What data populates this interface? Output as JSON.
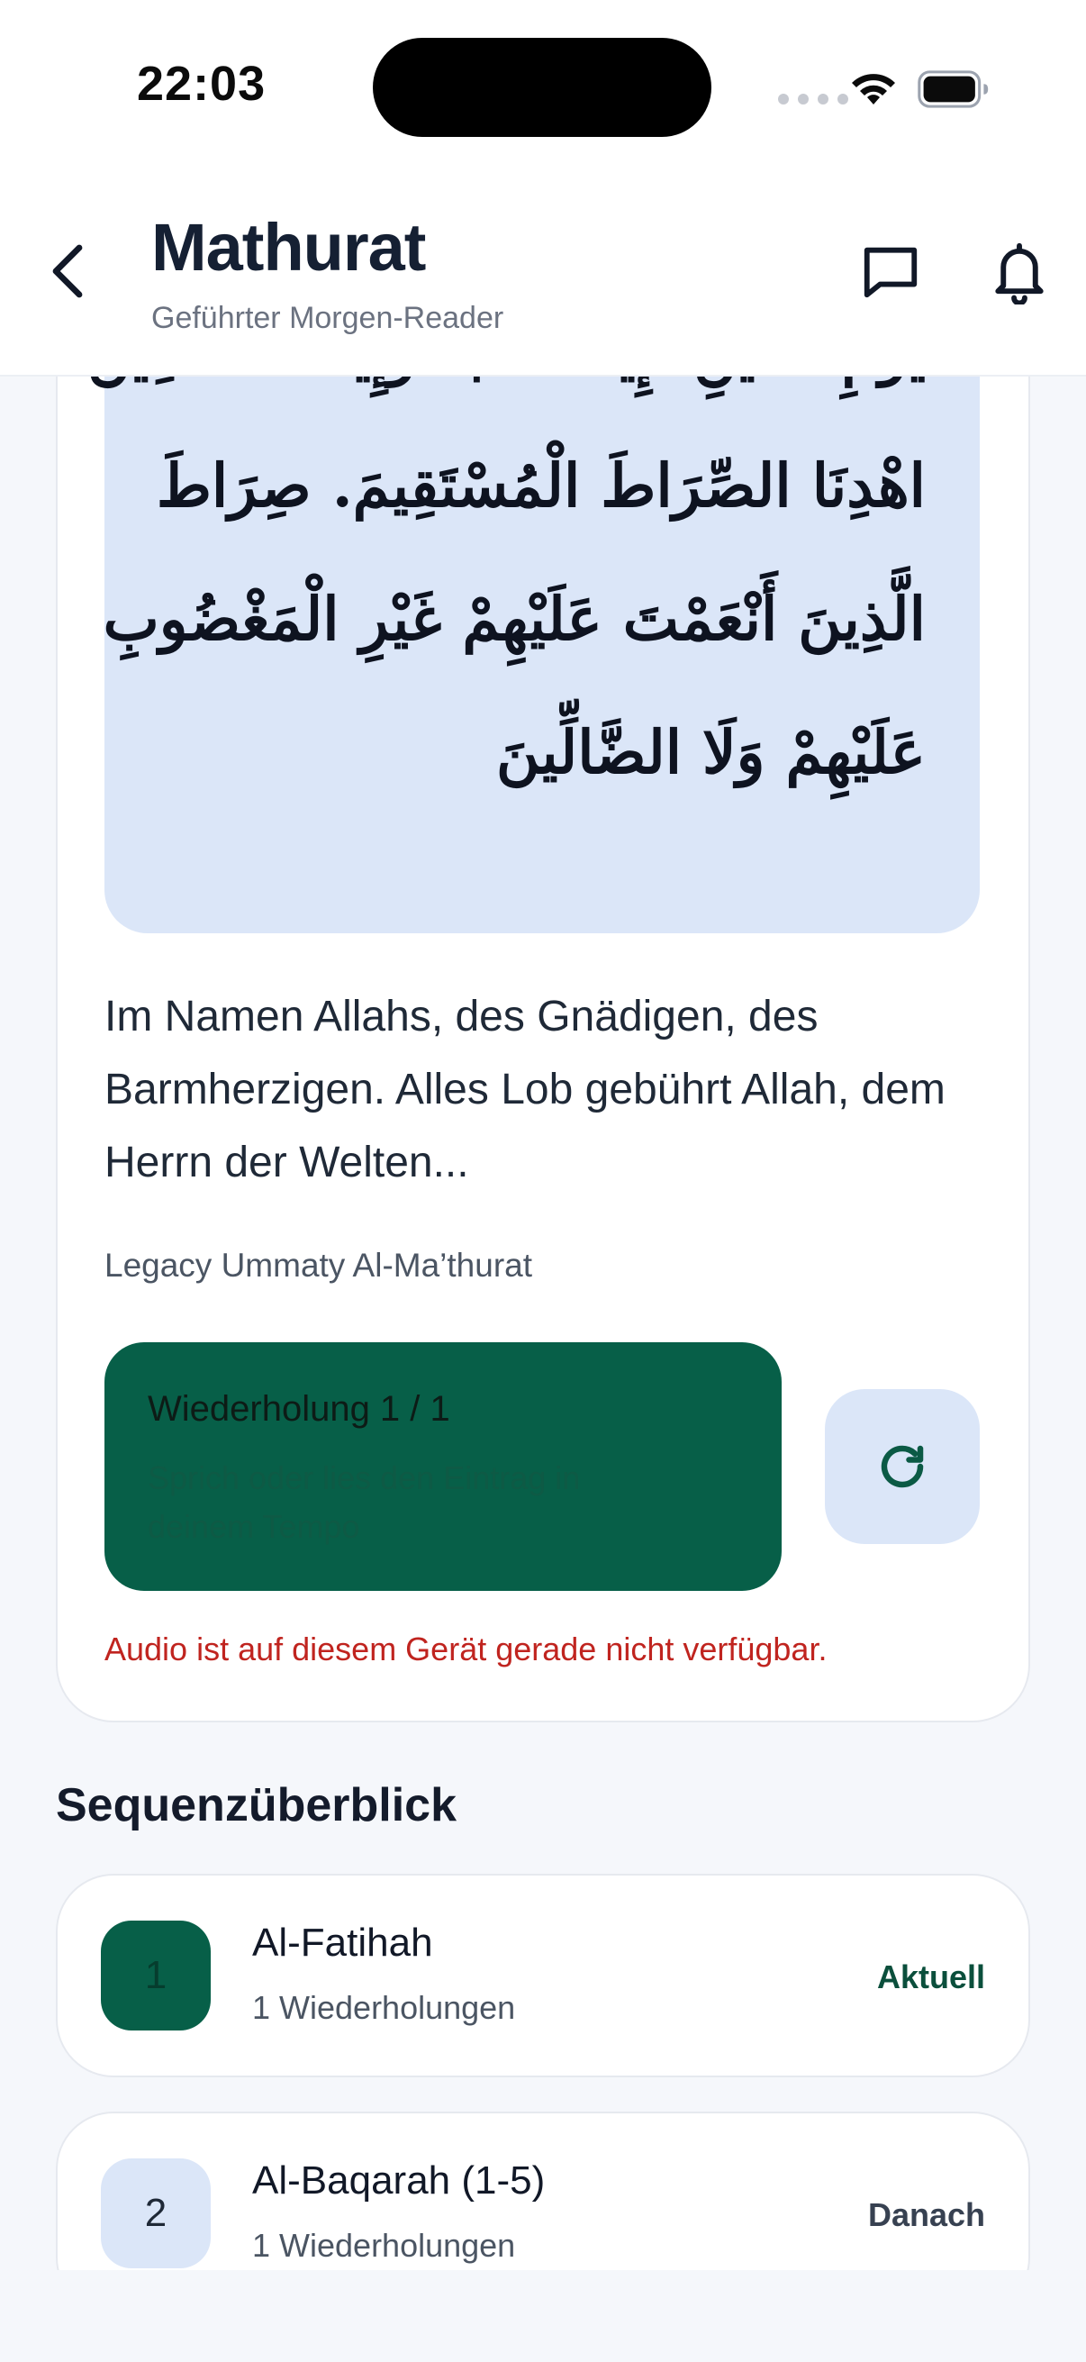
{
  "status_bar": {
    "time": "22:03"
  },
  "header": {
    "title": "Mathurat",
    "subtitle": "Geführter Morgen-Reader"
  },
  "reader": {
    "arabic_lines": [
      "يَوْمِ الدِّينِ. إِيَّاكَ نَعْبُدُ وَإِيَّاكَ نَسْتَعِينُ.",
      "اهْدِنَا الصِّرَاطَ الْمُسْتَقِيمَ. صِرَاطَ",
      "الَّذِينَ أَنْعَمْتَ عَلَيْهِمْ غَيْرِ الْمَغْضُوبِ",
      "عَلَيْهِمْ وَلَا الضَّالِّينَ"
    ],
    "translation": "Im Namen Allahs, des Gnädigen, des Barmherzigen. Alles Lob gebührt Allah, dem Herrn der Welten...",
    "source": "Legacy Ummaty Al-Ma’thurat",
    "repetition_title": "Wiederholung 1 / 1",
    "repetition_hint": "Sprich oder lies den Eintrag in deinem Tempo",
    "audio_warning": "Audio ist auf diesem Gerät gerade nicht verfügbar."
  },
  "sequence": {
    "title": "Sequenzüberblick",
    "items": [
      {
        "number": "1",
        "name": "Al-Fatihah",
        "reps": "1 Wiederholungen",
        "status": "Aktuell"
      },
      {
        "number": "2",
        "name": "Al-Baqarah (1-5)",
        "reps": "1 Wiederholungen",
        "status": "Danach"
      }
    ]
  },
  "colors": {
    "accent_green": "#075f48",
    "arabic_bg": "#dbe6f8",
    "warning_red": "#c0241f"
  },
  "icons": [
    "back-chevron-icon",
    "chat-icon",
    "bell-icon",
    "refresh-icon",
    "wifi-icon",
    "battery-icon"
  ]
}
